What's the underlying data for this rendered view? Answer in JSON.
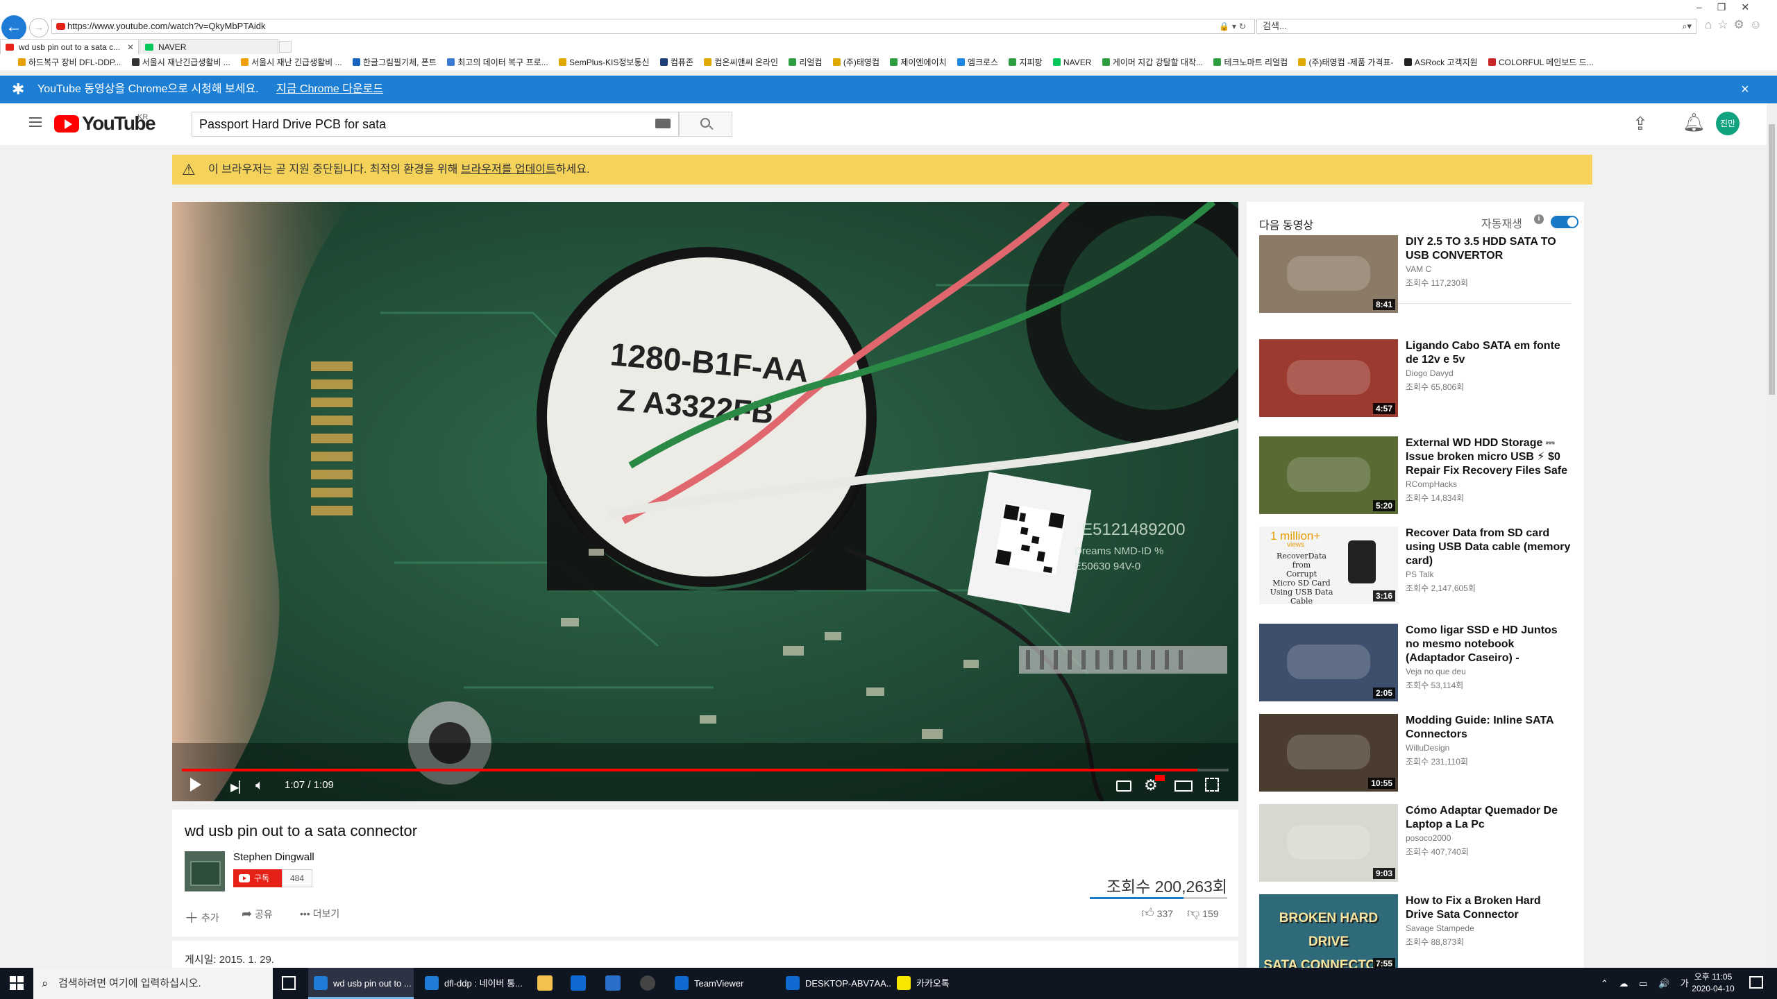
{
  "browser": {
    "url": "https://www.youtube.com/watch?v=QkyMbPTAidk",
    "search_placeholder": "검색...",
    "tabs": [
      {
        "label": "wd usb pin out to a sata c...",
        "active": true
      },
      {
        "label": "NAVER",
        "active": false
      }
    ],
    "favorites": [
      "하드복구 장비 DFL-DDP...",
      "서울시 재난긴급생활비 ...",
      "서울시 재난 긴급생활비 ...",
      "한글그림필기체, 폰트",
      "최고의 데이터 복구 프로...",
      "SemPlus-KIS정보통신",
      "컴퓨존",
      "컴온씨앤씨 온라인",
      "리얼컴",
      "(주)태영컴",
      "제이엔에이치",
      "엠크로스",
      "지피팡",
      "NAVER",
      "게이머 지갑 강탈할 대작...",
      "테크노마트 리얼컴",
      "(주)태영컴 -제품 가격표-",
      "ASRock 고객지원",
      "COLORFUL 메인보드 드..."
    ]
  },
  "chrome_banner": {
    "text": "YouTube 동영상을 Chrome으로 시청해 보세요.",
    "link": "지금 Chrome 다운로드",
    "close": "×"
  },
  "header": {
    "logo": "YouTube",
    "region": "KR",
    "search_value": "Passport Hard Drive PCB for sata",
    "avatar": "진만"
  },
  "warning": {
    "icon": "⚠",
    "text_before": "이 브라우저는 곧 지원 중단됩니다. 최적의 환경을 위해 ",
    "link": "브라우저를 업데이트",
    "text_after": "하세요."
  },
  "player": {
    "time": "1:07 / 1:09",
    "progress": 0.97,
    "board_text": [
      "1280-B1F-AA",
      "Z A3322FB"
    ],
    "board_label": [
      "E5121489200",
      "Dreams NMD-ID %",
      "E50630 94V-0"
    ]
  },
  "video": {
    "title": "wd usb pin out to a sata connector",
    "channel": "Stephen Dingwall",
    "subscribe_label": "구독",
    "subscribers": "484",
    "views": "조회수 200,263회",
    "like_ratio": 0.68,
    "actions": {
      "add": "추가",
      "share": "공유",
      "more": "더보기"
    },
    "likes": "337",
    "dislikes": "159",
    "published": "게시일: 2015. 1. 29."
  },
  "sidebar": {
    "up_next": "다음 동영상",
    "autoplay_label": "자동재생",
    "autoplay_on": true,
    "accent": "#167ac6",
    "items": [
      {
        "title": "DIY 2.5 TO 3.5 HDD SATA TO USB CONVERTOR",
        "channel": "VAM C",
        "views": "조회수 117,230회",
        "duration": "8:41",
        "color": "#8a7a66"
      },
      {
        "title": "Ligando Cabo SATA em fonte de 12v e 5v",
        "channel": "Diogo Davyd",
        "views": "조회수 65,806회",
        "duration": "4:57",
        "color": "#9b3a2e"
      },
      {
        "title": "External WD HDD Storage ⎓ Issue broken micro USB ⚡ $0 Repair Fix Recovery Files Safe",
        "channel": "RCompHacks",
        "views": "조회수 14,834회",
        "duration": "5:20",
        "color": "#5a6a33"
      },
      {
        "title": "Recover Data from SD card using USB Data cable (memory card)",
        "channel": "PS Talk",
        "views": "조회수 2,147,605회",
        "duration": "3:16",
        "color": "#f4f4f4",
        "thumb_lines": [
          "1 million+",
          "views",
          "RecoverData",
          "from",
          "Corrupt",
          "Micro SD Card",
          "Using USB Data Cable"
        ]
      },
      {
        "title": "Como ligar SSD e HD Juntos no mesmo notebook (Adaptador Caseiro) -",
        "channel": "Veja no que deu",
        "views": "조회수 53,114회",
        "duration": "2:05",
        "color": "#3e4f6e"
      },
      {
        "title": "Modding Guide: Inline SATA Connectors",
        "channel": "WilluDesign",
        "views": "조회수 231,110회",
        "duration": "10:55",
        "color": "#4a3c2e"
      },
      {
        "title": "Cómo Adaptar Quemador De Laptop a La Pc",
        "channel": "posoco2000",
        "views": "조회수 407,740회",
        "duration": "9:03",
        "color": "#d8d8d0"
      },
      {
        "title": "How to Fix a Broken Hard Drive Sata Connector",
        "channel": "Savage Stampede",
        "views": "조회수 88,873회",
        "duration": "7:55",
        "color": "#2f6a7a",
        "thumb_lines": [
          "BROKEN HARD DRIVE",
          "SATA CONNECTOR?"
        ]
      }
    ]
  },
  "taskbar": {
    "search_placeholder": "검색하려면 여기에 입력하십시오.",
    "apps": [
      {
        "label": "wd usb pin out to ...",
        "active": true,
        "color": "#1e7bd6"
      },
      {
        "label": "dfl-ddp : 네이버 통...",
        "active": false,
        "color": "#1e7bd6"
      },
      {
        "label": "TeamViewer",
        "active": false,
        "color": "#0e6ad1"
      },
      {
        "label": "DESKTOP-ABV7AA...",
        "active": false,
        "color": "#0e6ad1"
      },
      {
        "label": "카카오톡",
        "active": false,
        "color": "#f7e600"
      }
    ],
    "tray": "⌃ ☁ ▭ 🔊 가",
    "time": "오후 11:05",
    "date": "2020-04-10"
  }
}
